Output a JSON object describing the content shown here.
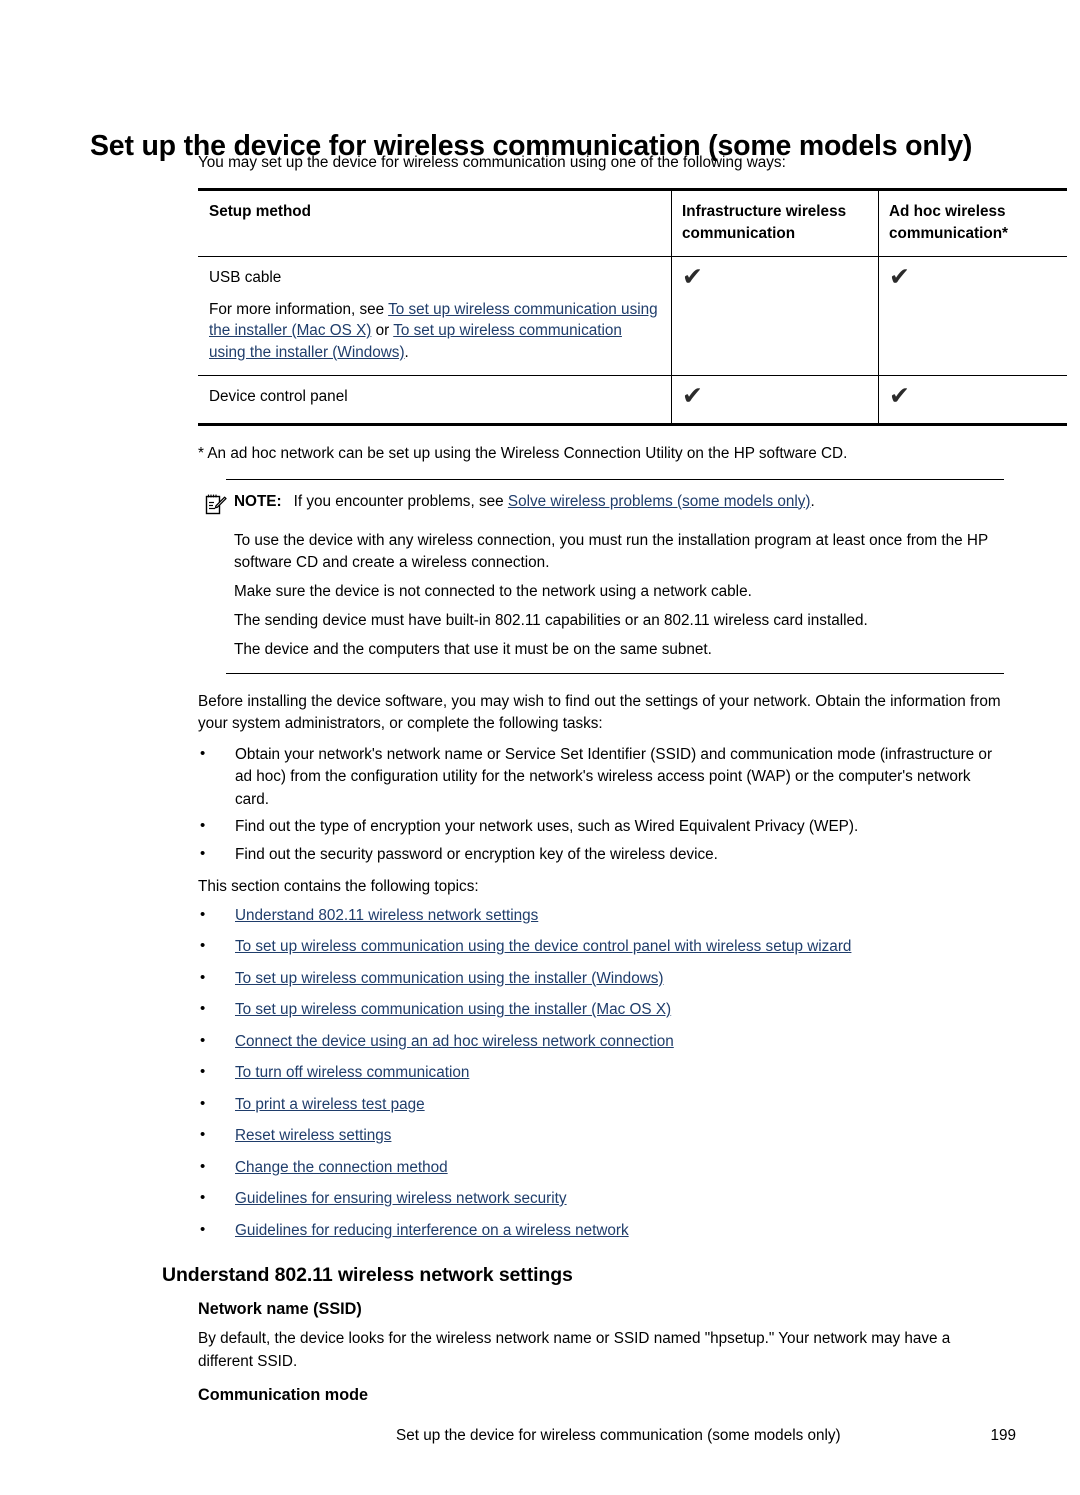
{
  "document": {
    "title": "Set up the device for wireless communication (some models only)",
    "intro": "You may set up the device for wireless communication using one of the following ways:"
  },
  "table": {
    "headers": {
      "method": "Setup method",
      "infrastructure": "Infrastructure wireless communication",
      "adhoc": "Ad hoc wireless communication*"
    },
    "rows": [
      {
        "method_title": "USB cable",
        "method_detail_prefix": "For more information, see ",
        "method_link_1": "To set up wireless communication using the installer (Mac OS X)",
        "method_detail_middle": " or ",
        "method_link_2": "To set up wireless communication using the installer (Windows)",
        "method_detail_suffix": ".",
        "infrastructure": "✔",
        "adhoc": "✔"
      },
      {
        "method_title": "Device control panel",
        "infrastructure": "✔",
        "adhoc": "✔"
      }
    ]
  },
  "footnote": "* An ad hoc network can be set up using the Wireless Connection Utility on the HP software CD.",
  "note": {
    "label": "NOTE:",
    "line1_prefix": "If you encounter problems, see ",
    "line1_link": "Solve wireless problems (some models only)",
    "line1_suffix": ".",
    "line2": "To use the device with any wireless connection, you must run the installation program at least once from the HP software CD and create a wireless connection.",
    "line3": "Make sure the device is not connected to the network using a network cable.",
    "line4": "The sending device must have built-in 802.11 capabilities or an 802.11 wireless card installed.",
    "line5": "The device and the computers that use it must be on the same subnet."
  },
  "before_install": {
    "paragraph": "Before installing the device software, you may wish to find out the settings of your network. Obtain the information from your system administrators, or complete the following tasks:",
    "tasks": [
      "Obtain your network's network name or Service Set Identifier (SSID) and communication mode (infrastructure or ad hoc) from the configuration utility for the network's wireless access point (WAP) or the computer's network card.",
      "Find out the type of encryption your network uses, such as Wired Equivalent Privacy (WEP).",
      "Find out the security password or encryption key of the wireless device."
    ]
  },
  "topics_intro": "This section contains the following topics:",
  "topics": [
    "Understand 802.11 wireless network settings",
    "To set up wireless communication using the device control panel with wireless setup wizard",
    "To set up wireless communication using the installer (Windows)",
    "To set up wireless communication using the installer (Mac OS X)",
    "Connect the device using an ad hoc wireless network connection",
    "To turn off wireless communication",
    "To print a wireless test page",
    "Reset wireless settings",
    "Change the connection method",
    "Guidelines for ensuring wireless network security",
    "Guidelines for reducing interference on a wireless network"
  ],
  "section": {
    "heading": "Understand 802.11 wireless network settings",
    "sub1_heading": "Network name (SSID)",
    "sub1_body": "By default, the device looks for the wireless network name or SSID named \"hpsetup.\" Your network may have a different SSID.",
    "sub2_heading": "Communication mode"
  },
  "footer": {
    "title": "Set up the device for wireless communication (some models only)",
    "page": "199"
  },
  "colors": {
    "link": "#1f3d6b",
    "text": "#000000",
    "rule": "#000000"
  }
}
